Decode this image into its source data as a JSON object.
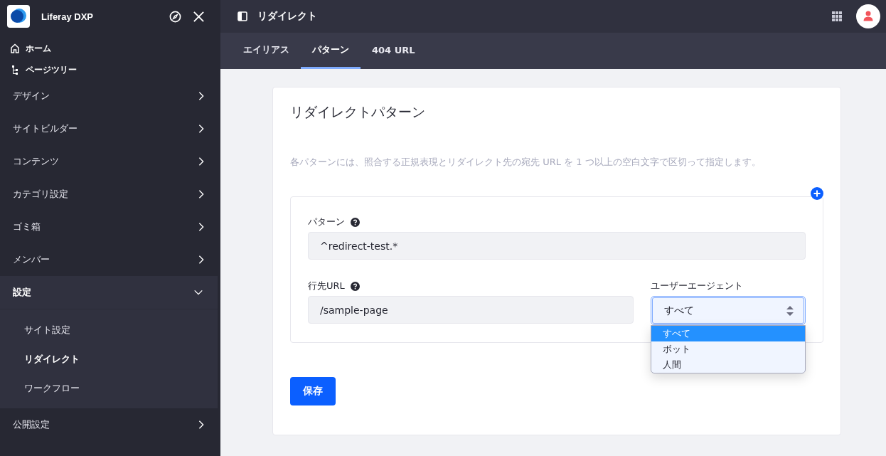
{
  "sidebar": {
    "brand": "Liferay DXP",
    "quick_links": [
      {
        "kind": "home",
        "label": "ホーム"
      },
      {
        "kind": "tree",
        "label": "ページツリー"
      }
    ],
    "sections": [
      {
        "label": "デザイン",
        "expanded": false
      },
      {
        "label": "サイトビルダー",
        "expanded": false
      },
      {
        "label": "コンテンツ",
        "expanded": false
      },
      {
        "label": "カテゴリ設定",
        "expanded": false
      },
      {
        "label": "ゴミ箱",
        "expanded": false
      },
      {
        "label": "メンバー",
        "expanded": false
      },
      {
        "label": "設定",
        "expanded": true,
        "children": [
          {
            "label": "サイト設定",
            "selected": false
          },
          {
            "label": "リダイレクト",
            "selected": true
          },
          {
            "label": "ワークフロー",
            "selected": false
          }
        ]
      },
      {
        "label": "公開設定",
        "expanded": false
      }
    ]
  },
  "header": {
    "title": "リダイレクト"
  },
  "tabs": [
    {
      "label": "エイリアス",
      "selected": false
    },
    {
      "label": "パターン",
      "selected": true
    },
    {
      "label": "404 URL",
      "selected": false
    }
  ],
  "card": {
    "title": "リダイレクトパターン",
    "description": "各パターンには、照合する正規表現とリダイレクト先の宛先 URL を 1 つ以上の空白文字で区切って指定します。",
    "pattern": {
      "label": "パターン",
      "value": "^redirect-test.*"
    },
    "destination": {
      "label": "行先URL",
      "value": "/sample-page"
    },
    "user_agent": {
      "label": "ユーザーエージェント",
      "value": "すべて",
      "options": [
        {
          "label": "すべて",
          "selected": true
        },
        {
          "label": "ボット",
          "selected": false
        },
        {
          "label": "人間",
          "selected": false
        }
      ]
    },
    "save_button": "保存"
  }
}
